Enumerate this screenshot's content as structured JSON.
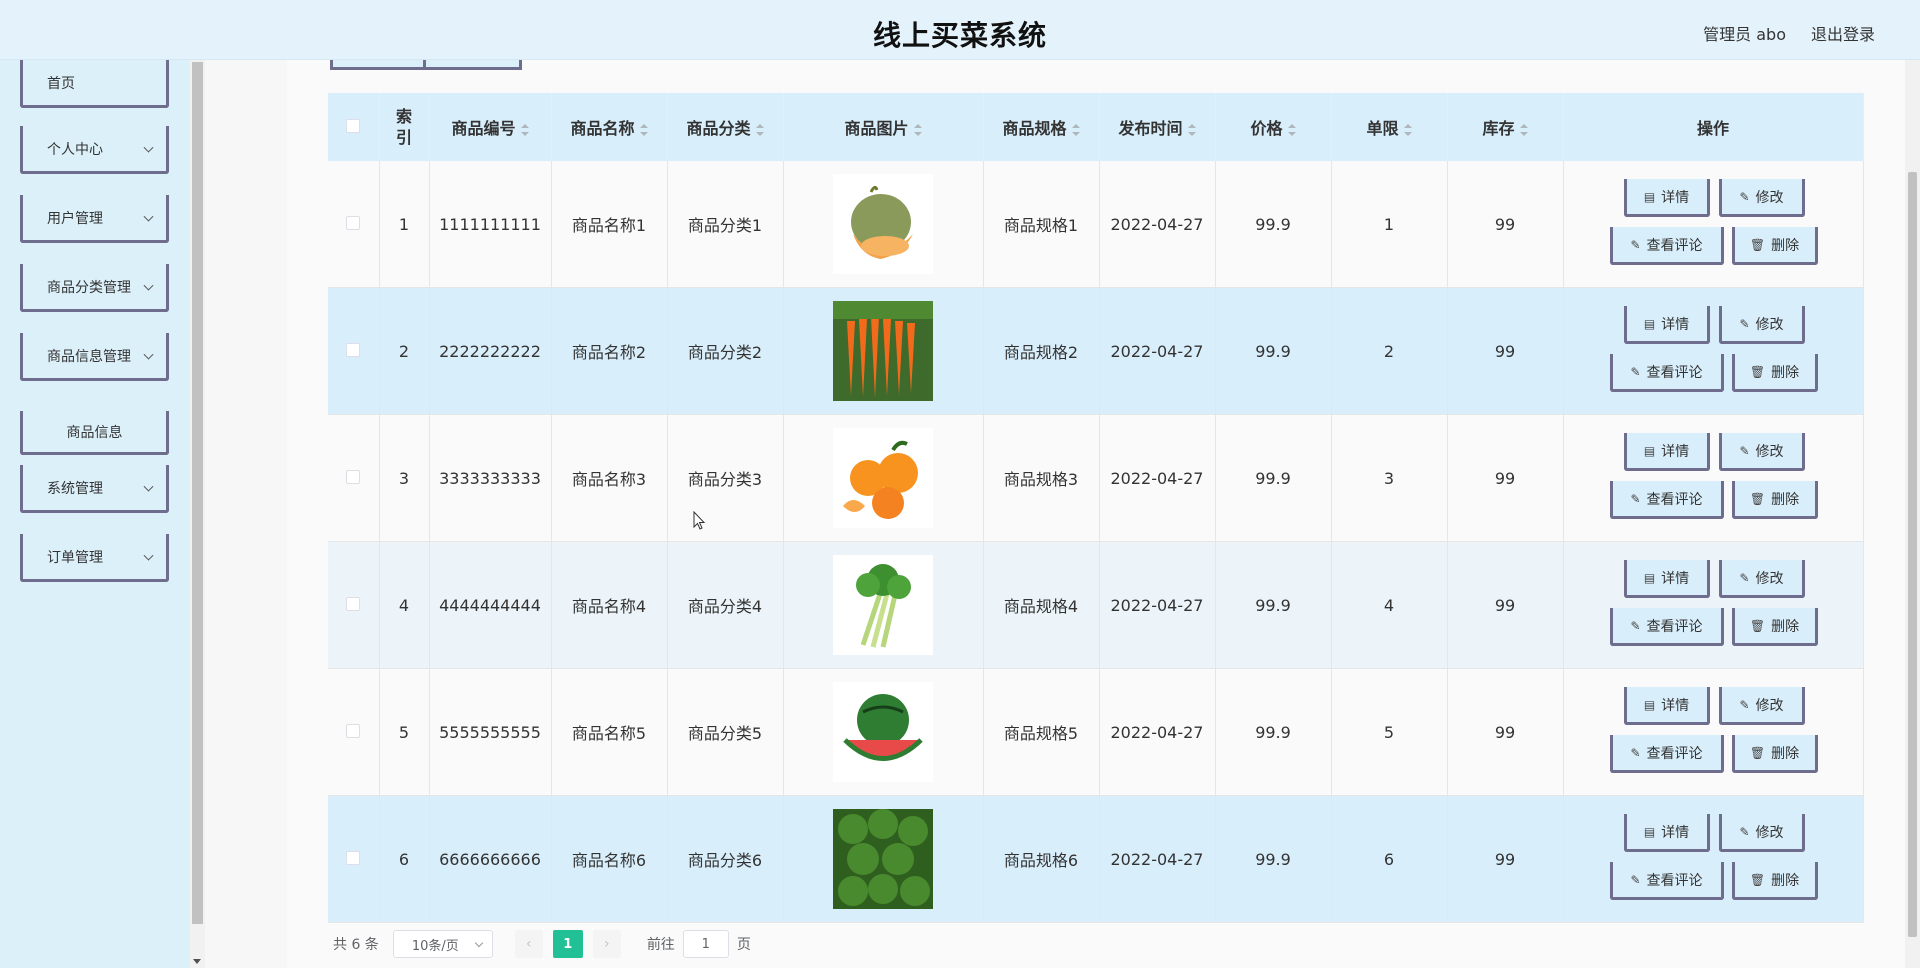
{
  "header": {
    "title": "线上买菜系统",
    "user": "管理员 abo",
    "logout": "退出登录"
  },
  "sidebar": {
    "items": [
      {
        "label": "首页",
        "has_arrow": false
      },
      {
        "label": "个人中心",
        "has_arrow": true
      },
      {
        "label": "用户管理",
        "has_arrow": true
      },
      {
        "label": "商品分类管理",
        "has_arrow": true
      },
      {
        "label": "商品信息管理",
        "has_arrow": true
      },
      {
        "label": "商品信息",
        "submenu": true
      },
      {
        "label": "系统管理",
        "has_arrow": true
      },
      {
        "label": "订单管理",
        "has_arrow": true
      }
    ]
  },
  "table": {
    "columns": [
      "索引",
      "商品编号",
      "商品名称",
      "商品分类",
      "商品图片",
      "商品规格",
      "发布时间",
      "价格",
      "单限",
      "库存",
      "操作"
    ],
    "rows": [
      {
        "index": "1",
        "code": "1111111111",
        "name": "商品名称1",
        "category": "商品分类1",
        "image": "cantaloupe",
        "spec": "商品规格1",
        "date": "2022-04-27",
        "price": "99.9",
        "limit": "1",
        "stock": "99"
      },
      {
        "index": "2",
        "code": "2222222222",
        "name": "商品名称2",
        "category": "商品分类2",
        "image": "carrots",
        "spec": "商品规格2",
        "date": "2022-04-27",
        "price": "99.9",
        "limit": "2",
        "stock": "99"
      },
      {
        "index": "3",
        "code": "3333333333",
        "name": "商品名称3",
        "category": "商品分类3",
        "image": "oranges",
        "spec": "商品规格3",
        "date": "2022-04-27",
        "price": "99.9",
        "limit": "3",
        "stock": "99"
      },
      {
        "index": "4",
        "code": "4444444444",
        "name": "商品名称4",
        "category": "商品分类4",
        "image": "celery",
        "spec": "商品规格4",
        "date": "2022-04-27",
        "price": "99.9",
        "limit": "4",
        "stock": "99"
      },
      {
        "index": "5",
        "code": "5555555555",
        "name": "商品名称5",
        "category": "商品分类5",
        "image": "watermelon",
        "spec": "商品规格5",
        "date": "2022-04-27",
        "price": "99.9",
        "limit": "5",
        "stock": "99"
      },
      {
        "index": "6",
        "code": "6666666666",
        "name": "商品名称6",
        "category": "商品分类6",
        "image": "broccoli",
        "spec": "商品规格6",
        "date": "2022-04-27",
        "price": "99.9",
        "limit": "6",
        "stock": "99"
      }
    ],
    "actions": {
      "detail": "详情",
      "edit": "修改",
      "comments": "查看评论",
      "delete": "删除"
    }
  },
  "pagination": {
    "total": "共 6 条",
    "page_size": "10条/页",
    "current_page": "1",
    "goto_prefix": "前往",
    "goto_value": "1",
    "goto_suffix": "页"
  },
  "colors": {
    "header_bg": "#e4f3fb",
    "sidebar_bg": "#dcf0fa",
    "button_border": "#6f6d8e",
    "row_highlight": "#d9eefb",
    "pager_active": "#22c195"
  }
}
